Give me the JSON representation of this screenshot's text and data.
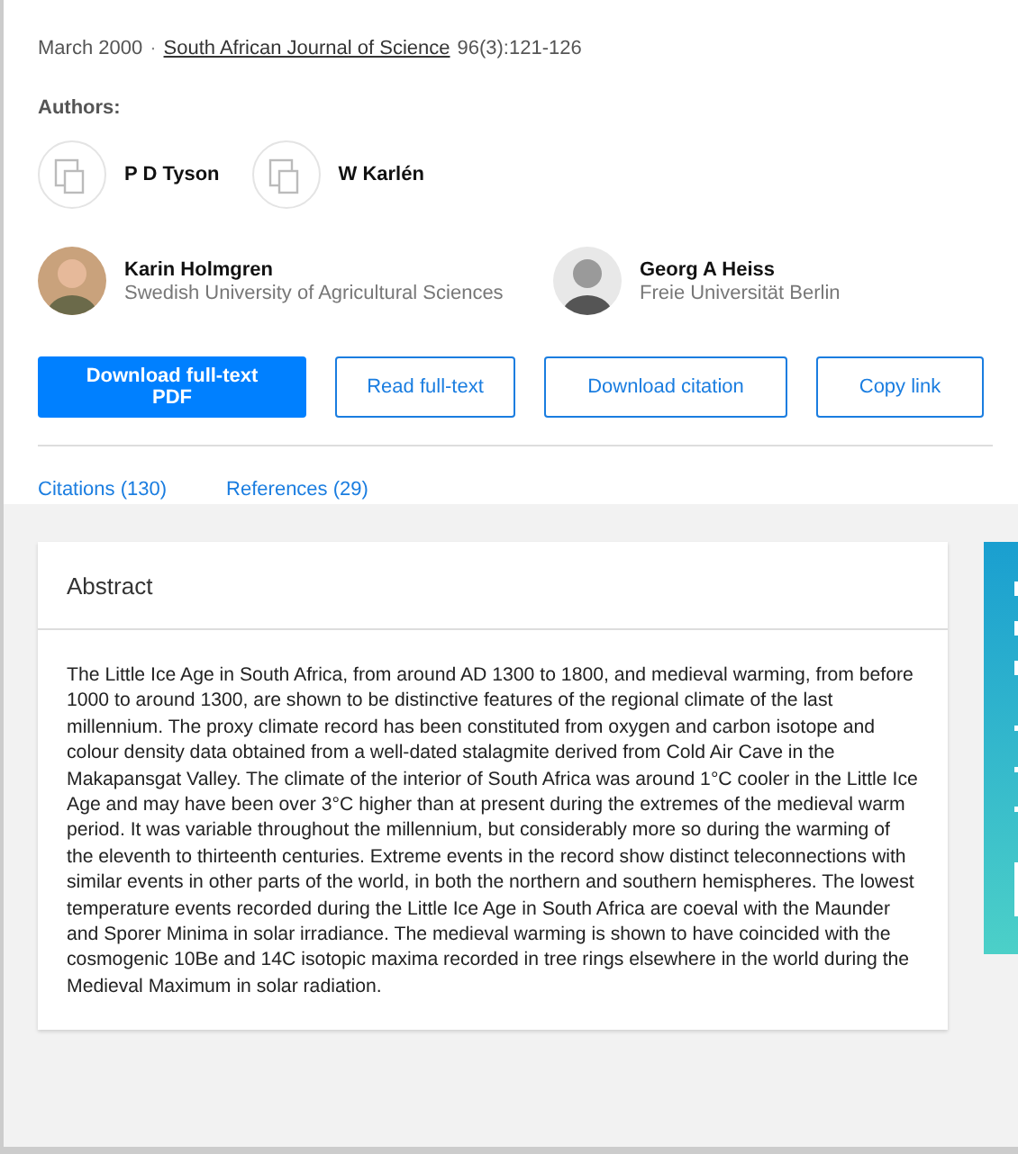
{
  "meta": {
    "date": "March 2000",
    "separator": "·",
    "journal": "South African Journal of Science",
    "issue": "96(3):121-126"
  },
  "authors_label": "Authors:",
  "authors": [
    {
      "kind": "placeholder",
      "name": "P D Tyson"
    },
    {
      "kind": "placeholder",
      "name": "W Karlén"
    },
    {
      "kind": "photo",
      "name": "Karin Holmgren",
      "affiliation": "Swedish University of Agricultural Sciences"
    },
    {
      "kind": "photo",
      "name": "Georg A Heiss",
      "affiliation": "Freie Universität Berlin"
    }
  ],
  "actions": [
    {
      "label": "Download full-text PDF",
      "kind": "primary"
    },
    {
      "label": "Read full-text",
      "kind": "outline"
    },
    {
      "label": "Download citation",
      "kind": "outline"
    },
    {
      "label": "Copy link",
      "kind": "outline"
    }
  ],
  "tabs": [
    {
      "label": "Citations (130)"
    },
    {
      "label": "References (29)"
    }
  ],
  "abstract": {
    "title": "Abstract",
    "text": "The Little Ice Age in South Africa, from around AD 1300 to 1800, and medieval warming, from before 1000 to around 1300, are shown to be distinctive features of the regional climate of the last millennium. The proxy climate record has been constituted from oxygen and carbon isotope and colour density data obtained from a well-dated stalagmite derived from Cold Air Cave in the Makapansgat Valley. The climate of the interior of South Africa was around 1°C cooler in the Little Ice Age and may have been over 3°C higher than at present during the extremes of the medieval warm period. It was variable throughout the millennium, but considerably more so during the warming of the eleventh to thirteenth centuries. Extreme events in the record show distinct teleconnections with similar events in other parts of the world, in both the northern and southern hemispheres. The lowest temperature events recorded during the Little Ice Age in South Africa are coeval with the Maunder and Sporer Minima in solar irradiance. The medieval warming is shown to have coincided with the cosmogenic 10Be and 14C isotopic maxima recorded in tree rings elsewhere in the world during the Medieval Maximum in solar radiation."
  }
}
